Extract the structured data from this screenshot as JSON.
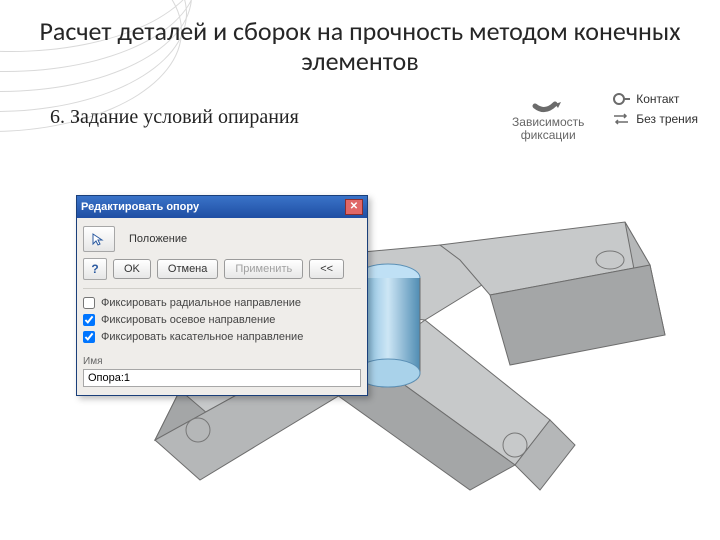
{
  "title": "Расчет деталей и сборок на прочность методом конечных элементов",
  "subtitle": "6. Задание условий опирания",
  "ribbon": {
    "fix_dep": "Зависимость фиксации",
    "contact": "Контакт",
    "frictionless": "Без трения"
  },
  "dialog": {
    "caption": "Редактировать опору",
    "position_label": "Положение",
    "ok": "OK",
    "cancel": "Отмена",
    "apply": "Применить",
    "collapse": "<<",
    "chk_radial": "Фиксировать радиальное направление",
    "chk_axial": "Фиксировать осевое направление",
    "chk_tangent": "Фиксировать касательное направление",
    "chk_radial_on": false,
    "chk_axial_on": true,
    "chk_tangent_on": true,
    "name_label": "Имя",
    "name_value": "Опора:1"
  }
}
